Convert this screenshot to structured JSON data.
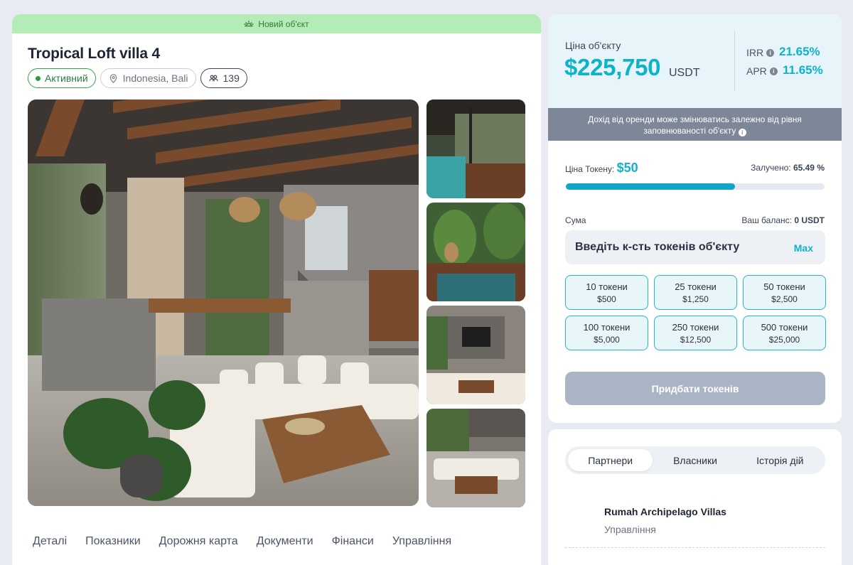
{
  "banner": {
    "label": "Новий об'єкт",
    "icon": "sunrise-icon"
  },
  "property": {
    "title": "Tropical Loft villa 4",
    "status": "Активний",
    "location": "Indonesia, Bali",
    "investors": "139"
  },
  "details_tabs": [
    "Деталі",
    "Показники",
    "Дорожня карта",
    "Документи",
    "Фінанси",
    "Управління"
  ],
  "pricing": {
    "label": "Ціна об'єкту",
    "value": "$225,750",
    "unit": "USDT",
    "irr_label": "IRR",
    "irr_value": "21.65%",
    "apr_label": "APR",
    "apr_value": "11.65%"
  },
  "notice": {
    "line1": "Дохід від оренди може змінюватись залежно від рівня",
    "line2": "заповнюваності об'єкту"
  },
  "token": {
    "price_label": "Ціна Токену:",
    "price_value": "$50",
    "raised_label": "Залучено:",
    "raised_value": "65.49 %",
    "raised_fraction": 0.6549
  },
  "purchase": {
    "sum_label": "Сума",
    "balance_label": "Ваш баланс:",
    "balance_value": "0 USDT",
    "input_placeholder": "Введіть к-сть токенів об'єкту",
    "max_label": "Max",
    "packs": [
      {
        "tokens": "10 токени",
        "price": "$500"
      },
      {
        "tokens": "25 токени",
        "price": "$1,250"
      },
      {
        "tokens": "50 токени",
        "price": "$2,500"
      },
      {
        "tokens": "100 токени",
        "price": "$5,000"
      },
      {
        "tokens": "250 токени",
        "price": "$12,500"
      },
      {
        "tokens": "500 токени",
        "price": "$25,000"
      }
    ],
    "buy_label": "Придбати токенів"
  },
  "partners_tabs": [
    "Партнери",
    "Власники",
    "Історія дій"
  ],
  "partner": {
    "name": "Rumah Archipelago Villas",
    "role": "Управління"
  },
  "colors": {
    "accent": "#0fb3c9",
    "active_green": "#2a9b3e",
    "banner_green": "#b4ecb7"
  }
}
